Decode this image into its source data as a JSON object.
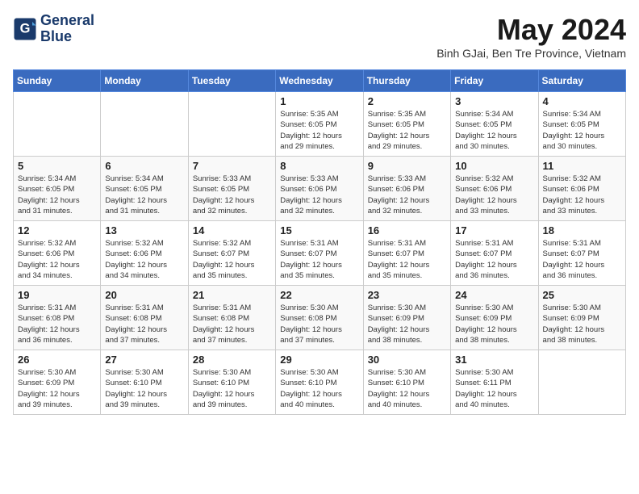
{
  "logo": {
    "line1": "General",
    "line2": "Blue"
  },
  "title": "May 2024",
  "location": "Binh GJai, Ben Tre Province, Vietnam",
  "headers": [
    "Sunday",
    "Monday",
    "Tuesday",
    "Wednesday",
    "Thursday",
    "Friday",
    "Saturday"
  ],
  "weeks": [
    [
      {
        "day": "",
        "info": ""
      },
      {
        "day": "",
        "info": ""
      },
      {
        "day": "",
        "info": ""
      },
      {
        "day": "1",
        "info": "Sunrise: 5:35 AM\nSunset: 6:05 PM\nDaylight: 12 hours\nand 29 minutes."
      },
      {
        "day": "2",
        "info": "Sunrise: 5:35 AM\nSunset: 6:05 PM\nDaylight: 12 hours\nand 29 minutes."
      },
      {
        "day": "3",
        "info": "Sunrise: 5:34 AM\nSunset: 6:05 PM\nDaylight: 12 hours\nand 30 minutes."
      },
      {
        "day": "4",
        "info": "Sunrise: 5:34 AM\nSunset: 6:05 PM\nDaylight: 12 hours\nand 30 minutes."
      }
    ],
    [
      {
        "day": "5",
        "info": "Sunrise: 5:34 AM\nSunset: 6:05 PM\nDaylight: 12 hours\nand 31 minutes."
      },
      {
        "day": "6",
        "info": "Sunrise: 5:34 AM\nSunset: 6:05 PM\nDaylight: 12 hours\nand 31 minutes."
      },
      {
        "day": "7",
        "info": "Sunrise: 5:33 AM\nSunset: 6:05 PM\nDaylight: 12 hours\nand 32 minutes."
      },
      {
        "day": "8",
        "info": "Sunrise: 5:33 AM\nSunset: 6:06 PM\nDaylight: 12 hours\nand 32 minutes."
      },
      {
        "day": "9",
        "info": "Sunrise: 5:33 AM\nSunset: 6:06 PM\nDaylight: 12 hours\nand 32 minutes."
      },
      {
        "day": "10",
        "info": "Sunrise: 5:32 AM\nSunset: 6:06 PM\nDaylight: 12 hours\nand 33 minutes."
      },
      {
        "day": "11",
        "info": "Sunrise: 5:32 AM\nSunset: 6:06 PM\nDaylight: 12 hours\nand 33 minutes."
      }
    ],
    [
      {
        "day": "12",
        "info": "Sunrise: 5:32 AM\nSunset: 6:06 PM\nDaylight: 12 hours\nand 34 minutes."
      },
      {
        "day": "13",
        "info": "Sunrise: 5:32 AM\nSunset: 6:06 PM\nDaylight: 12 hours\nand 34 minutes."
      },
      {
        "day": "14",
        "info": "Sunrise: 5:32 AM\nSunset: 6:07 PM\nDaylight: 12 hours\nand 35 minutes."
      },
      {
        "day": "15",
        "info": "Sunrise: 5:31 AM\nSunset: 6:07 PM\nDaylight: 12 hours\nand 35 minutes."
      },
      {
        "day": "16",
        "info": "Sunrise: 5:31 AM\nSunset: 6:07 PM\nDaylight: 12 hours\nand 35 minutes."
      },
      {
        "day": "17",
        "info": "Sunrise: 5:31 AM\nSunset: 6:07 PM\nDaylight: 12 hours\nand 36 minutes."
      },
      {
        "day": "18",
        "info": "Sunrise: 5:31 AM\nSunset: 6:07 PM\nDaylight: 12 hours\nand 36 minutes."
      }
    ],
    [
      {
        "day": "19",
        "info": "Sunrise: 5:31 AM\nSunset: 6:08 PM\nDaylight: 12 hours\nand 36 minutes."
      },
      {
        "day": "20",
        "info": "Sunrise: 5:31 AM\nSunset: 6:08 PM\nDaylight: 12 hours\nand 37 minutes."
      },
      {
        "day": "21",
        "info": "Sunrise: 5:31 AM\nSunset: 6:08 PM\nDaylight: 12 hours\nand 37 minutes."
      },
      {
        "day": "22",
        "info": "Sunrise: 5:30 AM\nSunset: 6:08 PM\nDaylight: 12 hours\nand 37 minutes."
      },
      {
        "day": "23",
        "info": "Sunrise: 5:30 AM\nSunset: 6:09 PM\nDaylight: 12 hours\nand 38 minutes."
      },
      {
        "day": "24",
        "info": "Sunrise: 5:30 AM\nSunset: 6:09 PM\nDaylight: 12 hours\nand 38 minutes."
      },
      {
        "day": "25",
        "info": "Sunrise: 5:30 AM\nSunset: 6:09 PM\nDaylight: 12 hours\nand 38 minutes."
      }
    ],
    [
      {
        "day": "26",
        "info": "Sunrise: 5:30 AM\nSunset: 6:09 PM\nDaylight: 12 hours\nand 39 minutes."
      },
      {
        "day": "27",
        "info": "Sunrise: 5:30 AM\nSunset: 6:10 PM\nDaylight: 12 hours\nand 39 minutes."
      },
      {
        "day": "28",
        "info": "Sunrise: 5:30 AM\nSunset: 6:10 PM\nDaylight: 12 hours\nand 39 minutes."
      },
      {
        "day": "29",
        "info": "Sunrise: 5:30 AM\nSunset: 6:10 PM\nDaylight: 12 hours\nand 40 minutes."
      },
      {
        "day": "30",
        "info": "Sunrise: 5:30 AM\nSunset: 6:10 PM\nDaylight: 12 hours\nand 40 minutes."
      },
      {
        "day": "31",
        "info": "Sunrise: 5:30 AM\nSunset: 6:11 PM\nDaylight: 12 hours\nand 40 minutes."
      },
      {
        "day": "",
        "info": ""
      }
    ]
  ]
}
